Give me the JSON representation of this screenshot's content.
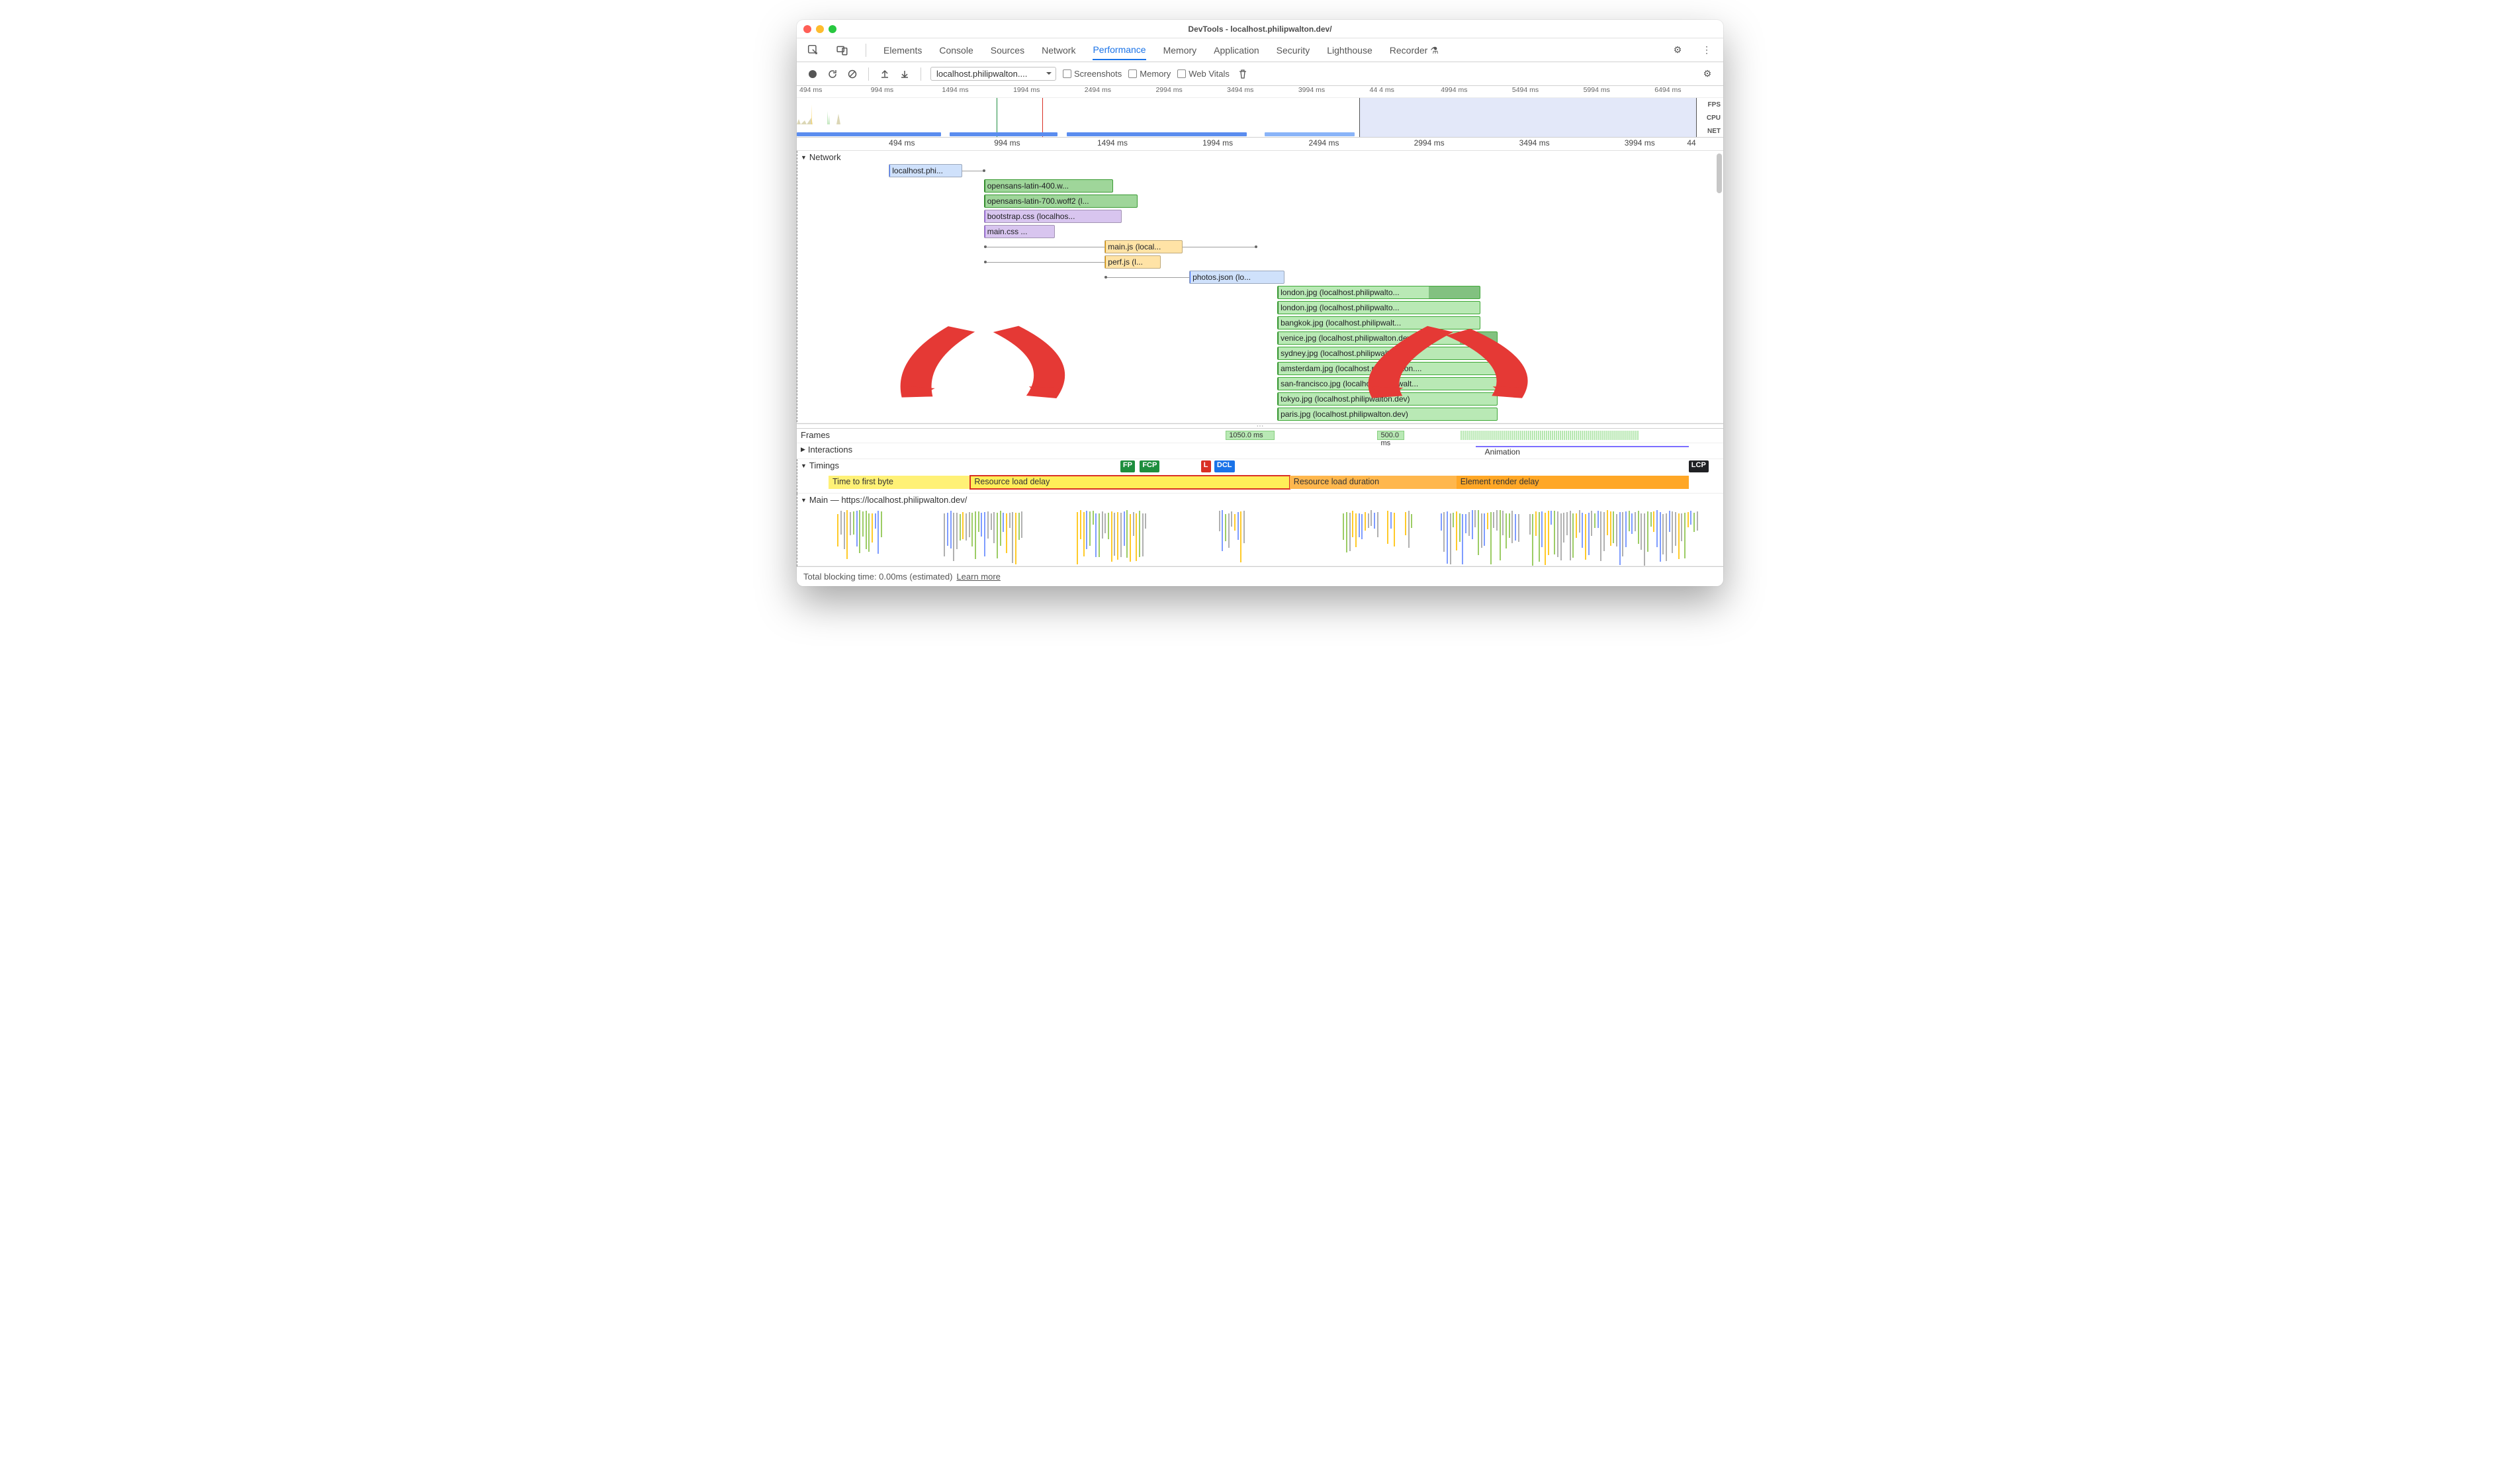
{
  "window": {
    "title": "DevTools - localhost.philipwalton.dev/"
  },
  "tabs": {
    "items": [
      "Elements",
      "Console",
      "Sources",
      "Network",
      "Performance",
      "Memory",
      "Application",
      "Security",
      "Lighthouse",
      "Recorder ⚗"
    ],
    "active": "Performance"
  },
  "toolbar": {
    "profile_select": "localhost.philipwalton....",
    "checkboxes": {
      "screenshots": "Screenshots",
      "memory": "Memory",
      "webvitals": "Web Vitals"
    }
  },
  "overview": {
    "ruler": [
      "494 ms",
      "994 ms",
      "1494 ms",
      "1994 ms",
      "2494 ms",
      "2994 ms",
      "3494 ms",
      "3994 ms",
      "44  4 ms",
      "4994 ms",
      "5494 ms",
      "5994 ms",
      "6494 ms"
    ],
    "right_labels": [
      "FPS",
      "CPU",
      "NET"
    ],
    "selection": {
      "start_pct": 62.5,
      "end_pct": 100
    },
    "green_line_pct": 22.2,
    "red_line_pct": 27.3
  },
  "ruler2": [
    {
      "label": "494 ms",
      "pct": 8.5
    },
    {
      "label": "994 ms",
      "pct": 20.7
    },
    {
      "label": "1494 ms",
      "pct": 32.9
    },
    {
      "label": "1994 ms",
      "pct": 45.1
    },
    {
      "label": "2494 ms",
      "pct": 57.4
    },
    {
      "label": "2994 ms",
      "pct": 69.6
    },
    {
      "label": "3494 ms",
      "pct": 81.8
    },
    {
      "label": "3994 ms",
      "pct": 94.0
    },
    {
      "label": "44",
      "pct": 100
    }
  ],
  "grid_pcts": [
    20.7,
    32.9,
    45.1,
    57.4,
    69.6
  ],
  "lanes": {
    "network_label": "Network",
    "frames_label": "Frames",
    "interactions_label": "Interactions",
    "timings_label": "Timings",
    "main_label": "Main — https://localhost.philipwalton.dev/"
  },
  "network": {
    "rows": [
      [
        {
          "cls": "c-doc",
          "text": "localhost.phi...",
          "left": 7.0,
          "w": 8.5,
          "tail": true,
          "tail_to": 17.9
        }
      ],
      [
        {
          "cls": "c-font",
          "text": "opensans-latin-400.w...",
          "left": 18.0,
          "w": 15.0
        }
      ],
      [
        {
          "cls": "c-font",
          "text": "opensans-latin-700.woff2 (l...",
          "left": 18.0,
          "w": 17.8
        }
      ],
      [
        {
          "cls": "c-css",
          "text": "bootstrap.css (localhos...",
          "left": 18.0,
          "w": 16.0
        }
      ],
      [
        {
          "cls": "c-css",
          "text": "main.css ...",
          "left": 18.0,
          "w": 8.2
        }
      ],
      [
        {
          "cls": "c-js",
          "text": "main.js (local...",
          "left": 32.0,
          "w": 9.0,
          "tail": true,
          "tail_to": 49.4,
          "lead_from": 18.0
        }
      ],
      [
        {
          "cls": "c-js",
          "text": "perf.js (l...",
          "left": 32.0,
          "w": 6.5,
          "lead_from": 18.0
        }
      ],
      [
        {
          "cls": "c-json",
          "text": "photos.json (lo...",
          "left": 41.8,
          "w": 11.0,
          "lead_from": 32.0
        }
      ],
      [
        {
          "cls": "c-img",
          "text": "london.jpg (localhost.philipwalto...",
          "left": 52.0,
          "w": 23.5,
          "dark_left": 69.6
        }
      ],
      [
        {
          "cls": "c-img",
          "text": "london.jpg (localhost.philipwalto...",
          "left": 52.0,
          "w": 23.5
        }
      ],
      [
        {
          "cls": "c-img",
          "text": "bangkok.jpg (localhost.philipwalt...",
          "left": 52.0,
          "w": 23.5
        }
      ],
      [
        {
          "cls": "c-img",
          "text": "venice.jpg (localhost.philipwalton.dev)",
          "left": 52.0,
          "w": 25.5,
          "dark_left": 73.2
        }
      ],
      [
        {
          "cls": "c-img",
          "text": "sydney.jpg (localhost.philipwalton...",
          "left": 52.0,
          "w": 24.5
        }
      ],
      [
        {
          "cls": "c-img",
          "text": "amsterdam.jpg (localhost.philipwalton....",
          "left": 52.0,
          "w": 25.5
        }
      ],
      [
        {
          "cls": "c-img",
          "text": "san-francisco.jpg (localhost.philipwalt...",
          "left": 52.0,
          "w": 25.5
        }
      ],
      [
        {
          "cls": "c-img",
          "text": "tokyo.jpg (localhost.philipwalton.dev)",
          "left": 52.0,
          "w": 25.5
        }
      ],
      [
        {
          "cls": "c-img",
          "text": "paris.jpg (localhost.philipwalton.dev)",
          "left": 52.0,
          "w": 25.5
        }
      ]
    ]
  },
  "frames": {
    "bars": [
      {
        "left": 44.8,
        "w": 5.5,
        "label": "1050.0 ms"
      },
      {
        "left": 61.9,
        "w": 3.0,
        "label": "500.0 ms"
      }
    ],
    "mini_left": 71.3,
    "animation_label": "Animation",
    "animation_left": 73.0
  },
  "timings": {
    "flags": [
      {
        "text": "FP",
        "cls": "green",
        "pct": 32.9
      },
      {
        "text": "FCP",
        "cls": "green",
        "pct": 35.1
      },
      {
        "text": "L",
        "cls": "red",
        "pct": 42.0
      },
      {
        "text": "DCL",
        "cls": "blue",
        "pct": 43.5
      },
      {
        "text": "LCP",
        "cls": "dark",
        "pct": 97.0
      }
    ]
  },
  "breakdown": {
    "segs": [
      {
        "cls": "y1",
        "text": "Time to first byte",
        "left": 0,
        "right": 16.0
      },
      {
        "cls": "y2",
        "text": "Resource load delay",
        "left": 16.0,
        "right": 52.0
      },
      {
        "cls": "o1",
        "text": "Resource load duration",
        "left": 52.0,
        "right": 70.8
      },
      {
        "cls": "o2",
        "text": "Element render delay",
        "left": 70.8,
        "right": 97.0
      }
    ]
  },
  "footer": {
    "tbt": "Total blocking time: 0.00ms (estimated)",
    "learn_more": "Learn more"
  }
}
